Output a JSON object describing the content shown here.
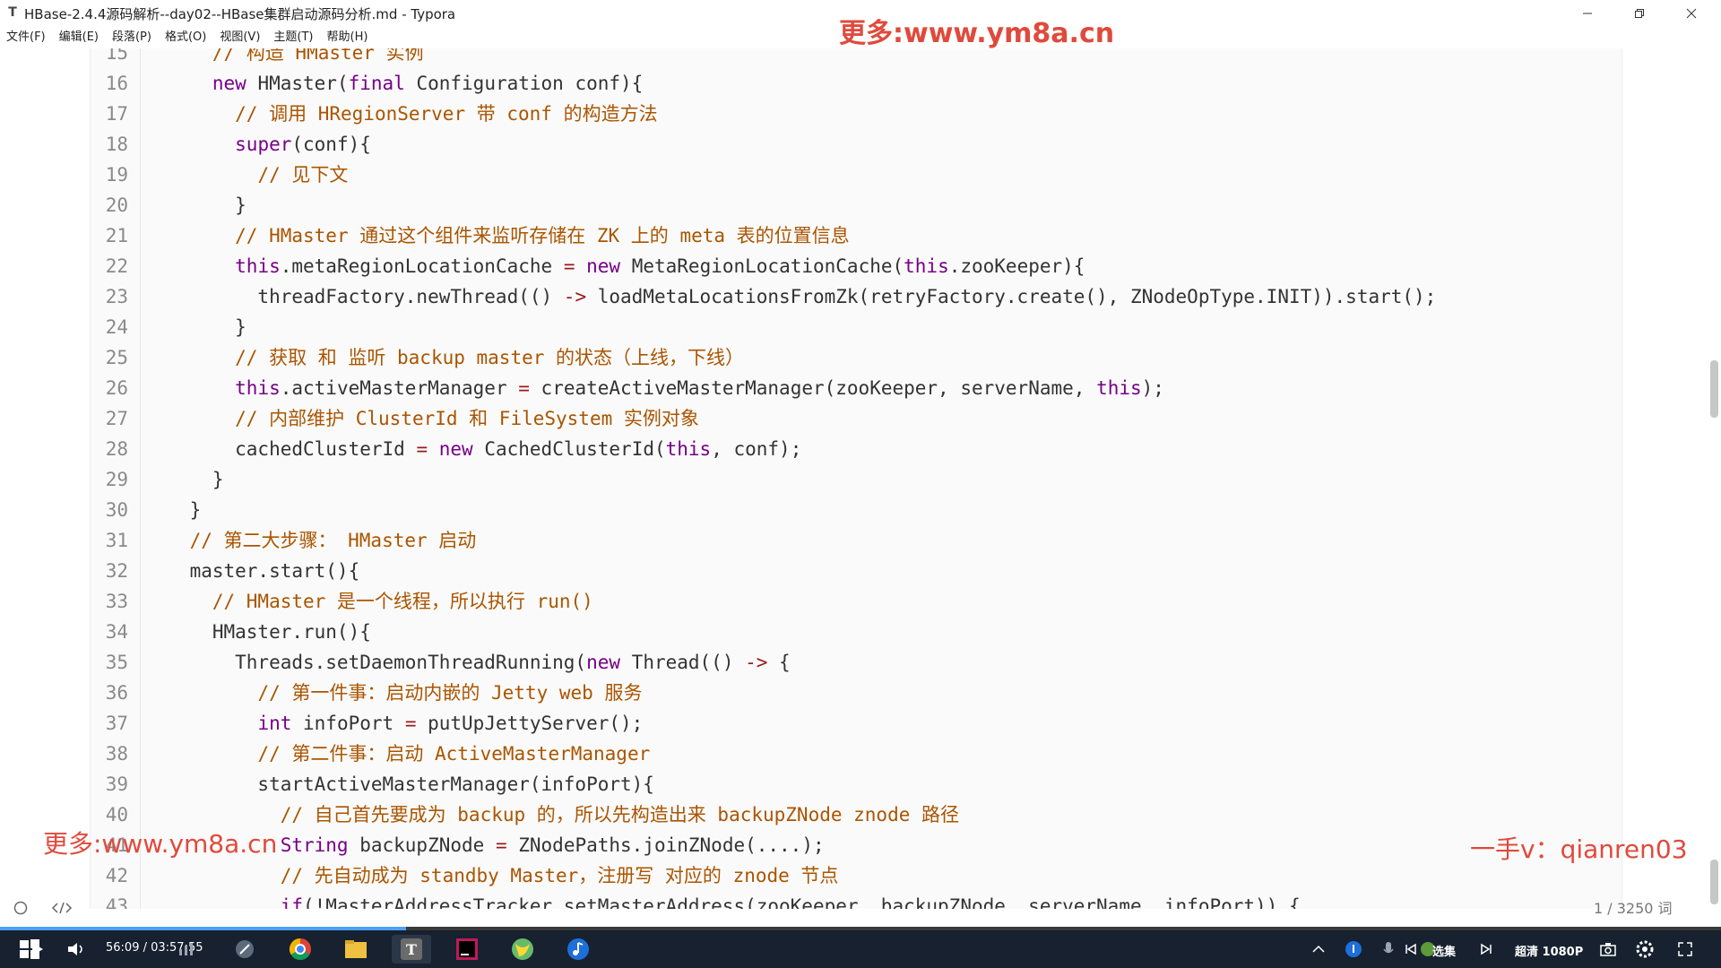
{
  "window": {
    "title": "HBase-2.4.4源码解析--day02--HBase集群启动源码分析.md - Typora",
    "app_icon_letter": "T"
  },
  "watermarks": {
    "top": "更多:www.ym8a.cn",
    "left": "更多:www.ym8a.cn",
    "right": "一手v：qianren03"
  },
  "menu": [
    "文件(F)",
    "编辑(E)",
    "段落(P)",
    "格式(O)",
    "视图(V)",
    "主题(T)",
    "帮助(H)"
  ],
  "code_lines": [
    {
      "n": "15",
      "segs": [
        [
          "      ",
          ""
        ],
        [
          "// 构造 HMaster 实例",
          "cm"
        ]
      ]
    },
    {
      "n": "16",
      "segs": [
        [
          "      ",
          ""
        ],
        [
          "new",
          "kw"
        ],
        [
          " HMaster(",
          ""
        ],
        [
          "final",
          "kw"
        ],
        [
          " Configuration conf){",
          ""
        ]
      ]
    },
    {
      "n": "17",
      "segs": [
        [
          "        ",
          ""
        ],
        [
          "// 调用 HRegionServer 带 conf 的构造方法",
          "cm"
        ]
      ]
    },
    {
      "n": "18",
      "segs": [
        [
          "        ",
          ""
        ],
        [
          "super",
          "kw"
        ],
        [
          "(conf){",
          ""
        ]
      ]
    },
    {
      "n": "19",
      "segs": [
        [
          "          ",
          ""
        ],
        [
          "// 见下文",
          "cm"
        ]
      ]
    },
    {
      "n": "20",
      "segs": [
        [
          "        }",
          ""
        ]
      ]
    },
    {
      "n": "21",
      "segs": [
        [
          "        ",
          ""
        ],
        [
          "// HMaster 通过这个组件来监听存储在 ZK 上的 meta 表的位置信息",
          "cm"
        ]
      ]
    },
    {
      "n": "22",
      "segs": [
        [
          "        ",
          ""
        ],
        [
          "this",
          "kw"
        ],
        [
          ".metaRegionLocationCache ",
          ""
        ],
        [
          "=",
          "op"
        ],
        [
          " ",
          ""
        ],
        [
          "new",
          "kw"
        ],
        [
          " MetaRegionLocationCache(",
          ""
        ],
        [
          "this",
          "kw"
        ],
        [
          ".zooKeeper){",
          ""
        ]
      ]
    },
    {
      "n": "23",
      "segs": [
        [
          "          threadFactory.newThread(() ",
          ""
        ],
        [
          "->",
          "op"
        ],
        [
          " loadMetaLocationsFromZk(retryFactory.create(), ZNodeOpType.INIT)).start();",
          ""
        ]
      ]
    },
    {
      "n": "24",
      "segs": [
        [
          "        }",
          ""
        ]
      ]
    },
    {
      "n": "25",
      "segs": [
        [
          "        ",
          ""
        ],
        [
          "// 获取 和 监听 backup master 的状态（上线，下线）",
          "cm"
        ]
      ]
    },
    {
      "n": "26",
      "segs": [
        [
          "        ",
          ""
        ],
        [
          "this",
          "kw"
        ],
        [
          ".activeMasterManager ",
          ""
        ],
        [
          "=",
          "op"
        ],
        [
          " createActiveMasterManager(zooKeeper, serverName, ",
          ""
        ],
        [
          "this",
          "kw"
        ],
        [
          ");",
          ""
        ]
      ]
    },
    {
      "n": "27",
      "segs": [
        [
          "        ",
          ""
        ],
        [
          "// 内部维护 ClusterId 和 FileSystem 实例对象",
          "cm"
        ]
      ]
    },
    {
      "n": "28",
      "segs": [
        [
          "        cachedClusterId ",
          ""
        ],
        [
          "=",
          "op"
        ],
        [
          " ",
          ""
        ],
        [
          "new",
          "kw"
        ],
        [
          " CachedClusterId(",
          ""
        ],
        [
          "this",
          "kw"
        ],
        [
          ", conf);",
          ""
        ]
      ]
    },
    {
      "n": "29",
      "segs": [
        [
          "      }",
          ""
        ]
      ]
    },
    {
      "n": "30",
      "segs": [
        [
          "    }",
          ""
        ]
      ]
    },
    {
      "n": "31",
      "segs": [
        [
          "    ",
          ""
        ],
        [
          "// 第二大步骤： HMaster 启动",
          "cm"
        ]
      ]
    },
    {
      "n": "32",
      "segs": [
        [
          "    master.start(){",
          ""
        ]
      ]
    },
    {
      "n": "33",
      "segs": [
        [
          "      ",
          ""
        ],
        [
          "// HMaster 是一个线程，所以执行 run()",
          "cm"
        ]
      ]
    },
    {
      "n": "34",
      "segs": [
        [
          "      HMaster.run(){",
          ""
        ]
      ]
    },
    {
      "n": "35",
      "segs": [
        [
          "        Threads.setDaemonThreadRunning(",
          ""
        ],
        [
          "new",
          "kw"
        ],
        [
          " Thread(() ",
          ""
        ],
        [
          "->",
          "op"
        ],
        [
          " {",
          ""
        ]
      ]
    },
    {
      "n": "36",
      "segs": [
        [
          "          ",
          ""
        ],
        [
          "// 第一件事：启动内嵌的 Jetty web 服务",
          "cm"
        ]
      ]
    },
    {
      "n": "37",
      "segs": [
        [
          "          ",
          ""
        ],
        [
          "int",
          "kw"
        ],
        [
          " infoPort ",
          ""
        ],
        [
          "=",
          "op"
        ],
        [
          " putUpJettyServer();",
          ""
        ]
      ]
    },
    {
      "n": "38",
      "segs": [
        [
          "          ",
          ""
        ],
        [
          "// 第二件事：启动 ActiveMasterManager",
          "cm"
        ]
      ]
    },
    {
      "n": "39",
      "segs": [
        [
          "          startActiveMasterManager(infoPort){",
          ""
        ]
      ]
    },
    {
      "n": "40",
      "segs": [
        [
          "            ",
          ""
        ],
        [
          "// 自己首先要成为 backup 的，所以先构造出来 backupZNode znode 路径",
          "cm"
        ]
      ]
    },
    {
      "n": "41",
      "segs": [
        [
          "            ",
          ""
        ],
        [
          "String",
          "kw"
        ],
        [
          " backupZNode ",
          ""
        ],
        [
          "=",
          "op"
        ],
        [
          " ZNodePaths.joinZNode(....);",
          ""
        ]
      ]
    },
    {
      "n": "42",
      "segs": [
        [
          "            ",
          ""
        ],
        [
          "// 先自动成为 standby Master，注册写 对应的 znode 节点",
          "cm"
        ]
      ]
    },
    {
      "n": "43",
      "segs": [
        [
          "            ",
          ""
        ],
        [
          "if",
          "kw"
        ],
        [
          "(!MasterAddressTracker.setMasterAddress(zooKeeper, backupZNode, serverName, infoPort)) {",
          ""
        ]
      ]
    }
  ],
  "status": {
    "word_count": "1 / 3250 词"
  },
  "player": {
    "time": "56:09 / 03:57:55",
    "progress": 0.236,
    "select_episode": "选集",
    "quality": "超清 1080P"
  },
  "colors": {
    "keyword": "#770088",
    "comment": "#aa5500",
    "operator": "#981a1a",
    "watermark": "#e04a3c",
    "taskbar": "#17212f",
    "progress": "#4ea0ff"
  }
}
